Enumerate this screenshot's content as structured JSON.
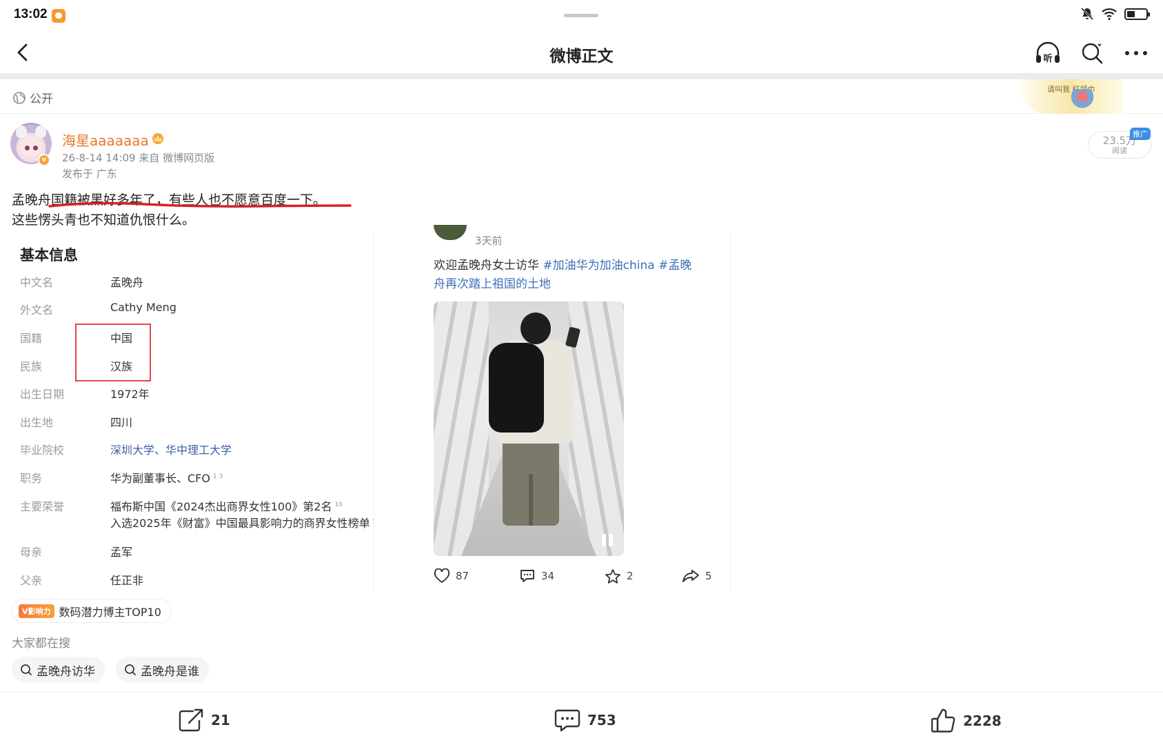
{
  "status_bar": {
    "time": "13:02",
    "icons": [
      "app-notification-icon",
      "mute-bell-icon",
      "wifi-icon",
      "battery-icon"
    ]
  },
  "nav": {
    "title": "微博正文",
    "actions": [
      "listen-icon",
      "search-refresh-icon",
      "more-icon"
    ],
    "listen_glyph": "听"
  },
  "visibility": {
    "label": "公开",
    "icon": "globe-icon"
  },
  "banner": {
    "text": "请叫我 红领巾"
  },
  "post": {
    "username": "海星aaaaaaa",
    "datetime_source": "26-8-14 14:09  来自 微博网页版",
    "location": "发布于 广东",
    "read_count": "23.5万",
    "read_label": "阅读",
    "promo_tag": "推广",
    "verify_glyph": "v",
    "text_line1": "孟晚舟国籍被黑好多年了，有些人也不愿意百度一下。",
    "text_line2": "这些愣头青也不知道仇恨什么。",
    "underline_color": "#d6202a"
  },
  "embed": {
    "info_title": "基本信息",
    "rows": [
      {
        "label": "中文名",
        "value": "孟晚舟"
      },
      {
        "label": "外文名",
        "value": "Cathy Meng"
      },
      {
        "label": "国籍",
        "value": "中国"
      },
      {
        "label": "民族",
        "value": "汉族"
      },
      {
        "label": "出生日期",
        "value": "1972年"
      },
      {
        "label": "出生地",
        "value": "四川"
      },
      {
        "label": "毕业院校",
        "value": "深圳大学、华中理工大学"
      },
      {
        "label": "职务",
        "value": "华为副董事长、CFO",
        "refs": "1  3"
      },
      {
        "label": "主要荣誉",
        "value": "福布斯中国《2024杰出商界女性100》第2名",
        "refs": "10"
      },
      {
        "label": "",
        "value": "入选2025年《财富》中国最具影响力的商界女性榜单",
        "refs": "9"
      },
      {
        "label": "母亲",
        "value": "孟军"
      },
      {
        "label": "父亲",
        "value": "任正非"
      }
    ],
    "highlight_color": "#e5434f",
    "feed": {
      "time": "3天前",
      "text_plain": "欢迎孟晚舟女士访华 ",
      "tag1": "#加油华为加油china",
      "tag2_a": " #孟晚",
      "tag2_b": "舟再次踏上祖国的土地",
      "likes": "87",
      "comments": "34",
      "favorites": "2",
      "shares": "5"
    }
  },
  "influence_badge": {
    "tag": "V影响力",
    "label": "数码潜力博主TOP10"
  },
  "search": {
    "label": "大家都在搜",
    "chips": [
      "孟晚舟访华",
      "孟晚舟是谁"
    ]
  },
  "bottom_bar": {
    "reposts": "21",
    "comments": "753",
    "likes": "2228"
  }
}
